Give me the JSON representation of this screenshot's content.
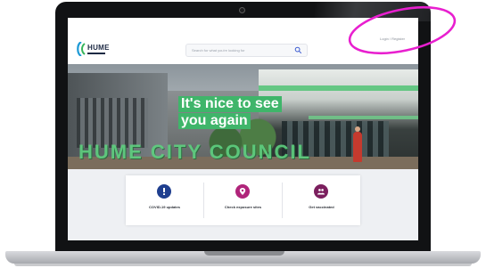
{
  "site": {
    "logo_text": "HUME"
  },
  "header": {
    "search_placeholder": "Search for what you're looking for",
    "login_text": "Login / Register"
  },
  "hero": {
    "headline_line1": "It's nice to see",
    "headline_line2": "you again",
    "sign_text": "HUME CITY COUNCIL"
  },
  "quick_links": [
    {
      "label": "COVID-19 updates",
      "icon": "exclamation-icon",
      "color": "#1f3f8f"
    },
    {
      "label": "Check exposure sites",
      "icon": "location-pin-icon",
      "color": "#b0247a"
    },
    {
      "label": "Get vaccinated",
      "icon": "people-icon",
      "color": "#7b1f5e"
    }
  ],
  "colors": {
    "brand_green": "#3fb56a",
    "annotation_circle": "#e81fcf"
  }
}
